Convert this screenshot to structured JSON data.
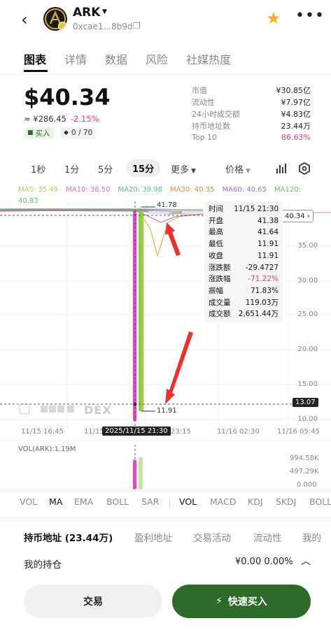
{
  "header": {
    "token_name": "ARK",
    "address": "0xcae1...8b9d"
  },
  "tabs": [
    {
      "label": "图表",
      "active": true
    },
    {
      "label": "详情",
      "active": false
    },
    {
      "label": "数据",
      "active": false
    },
    {
      "label": "风险",
      "active": false
    },
    {
      "label": "社媒热度",
      "active": false
    }
  ],
  "price": {
    "value": "$40.34",
    "cny": "≈ ¥286.45",
    "change": "-2.15%",
    "buy_badge": "买入",
    "security": "0 / 70"
  },
  "stats": [
    {
      "label": "市值",
      "value": "¥30.85亿",
      "highlight": false
    },
    {
      "label": "流动性",
      "value": "¥7.97亿",
      "highlight": false
    },
    {
      "label": "24小时成交额",
      "value": "¥4.83亿",
      "highlight": false
    },
    {
      "label": "持币地址数",
      "value": "23.44万",
      "highlight": false
    },
    {
      "label": "Top 10",
      "value": "86.63%",
      "highlight": true
    }
  ],
  "timeframes": {
    "items": [
      "1秒",
      "1分",
      "5分",
      "15分"
    ],
    "active": "15分",
    "more": "更多",
    "price_mode": "价格"
  },
  "ma": [
    {
      "label": "MA5: 35.49",
      "color": "#d8b84a"
    },
    {
      "label": "MA10: 38.50",
      "color": "#d46fc0"
    },
    {
      "label": "MA20: 39.98",
      "color": "#4fb8b0"
    },
    {
      "label": "MA30: 40.35",
      "color": "#e58a3a"
    },
    {
      "label": "MA60: 40.65",
      "color": "#9b6fd4"
    },
    {
      "label": "MA120:",
      "color": "#6dbf6a"
    },
    {
      "label": "40.83",
      "color": "#6dbf6a"
    }
  ],
  "chart": {
    "high_label": "41.78",
    "low_label": "11.91",
    "current_price_tag": "40.34",
    "cursor_price_tag": "13.07",
    "y_axis": [
      "35.00",
      "30.00",
      "25.00",
      "20.00",
      "15.00",
      "10.00"
    ],
    "x_axis": [
      "11/15 16:45",
      "11/15",
      "23:15",
      "11/16 02:30",
      "11/16 05:45"
    ],
    "cursor_time": "2025/11/15 21:30",
    "watermark": "DEX"
  },
  "tooltip": [
    {
      "label": "时间",
      "value": "11/15 21:30",
      "color": "#222"
    },
    {
      "label": "开盘",
      "value": "41.38",
      "color": "#222"
    },
    {
      "label": "最高",
      "value": "41.64",
      "color": "#222"
    },
    {
      "label": "最低",
      "value": "11.91",
      "color": "#222"
    },
    {
      "label": "收盘",
      "value": "11.91",
      "color": "#222"
    },
    {
      "label": "涨跌额",
      "value": "-29.4727",
      "color": "#222"
    },
    {
      "label": "涨跌幅",
      "value": "-71.22%",
      "color": "#d23f8c"
    },
    {
      "label": "振幅",
      "value": "71.83%",
      "color": "#222"
    },
    {
      "label": "成交量",
      "value": "119.03万",
      "color": "#222"
    },
    {
      "label": "成交额",
      "value": "2,651.44万",
      "color": "#222"
    }
  ],
  "volume": {
    "label": "VOL(ARK):1.19M",
    "axis": [
      "994.58K",
      "497.29K",
      "0.000"
    ]
  },
  "indicators": [
    {
      "label": "VOL",
      "dark": false
    },
    {
      "label": "MA",
      "dark": true
    },
    {
      "label": "EMA",
      "dark": false
    },
    {
      "label": "BOLL",
      "dark": false
    },
    {
      "label": "SAR",
      "dark": false
    },
    {
      "label": "VOL",
      "dark": true
    },
    {
      "label": "MACD",
      "dark": false
    },
    {
      "label": "KDJ",
      "dark": false
    },
    {
      "label": "SKDJ",
      "dark": false
    },
    {
      "label": "BOLL",
      "dark": false
    }
  ],
  "bottom_tabs": [
    {
      "label": "持币地址 (23.44万)",
      "active": true
    },
    {
      "label": "盈利地址",
      "active": false
    },
    {
      "label": "交易活动",
      "active": false
    },
    {
      "label": "流动性",
      "active": false
    },
    {
      "label": "我的",
      "active": false
    }
  ],
  "holdings": {
    "label": "我的持仓",
    "value": "¥0.00 0.00%"
  },
  "actions": {
    "trade": "交易",
    "quick_buy": "快速买入"
  },
  "colors": {
    "accent_red": "#d23f8c",
    "buy_green": "#2e6b2a",
    "candle_green": "#9bd04a",
    "candle_pink": "#d94fbf",
    "star": "#f0b429"
  }
}
